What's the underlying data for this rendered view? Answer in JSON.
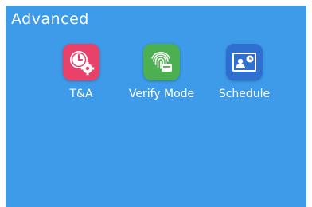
{
  "screen": {
    "title": "Advanced",
    "background": "#3d9bea"
  },
  "apps": [
    {
      "label": "T&A",
      "icon": "clock-gear-icon",
      "color": "#e8416a"
    },
    {
      "label": "Verify Mode",
      "icon": "fingerprint-card-icon",
      "color": "#4caf50"
    },
    {
      "label": "Schedule",
      "icon": "user-clock-card-icon",
      "color": "#2f6fd0"
    }
  ]
}
